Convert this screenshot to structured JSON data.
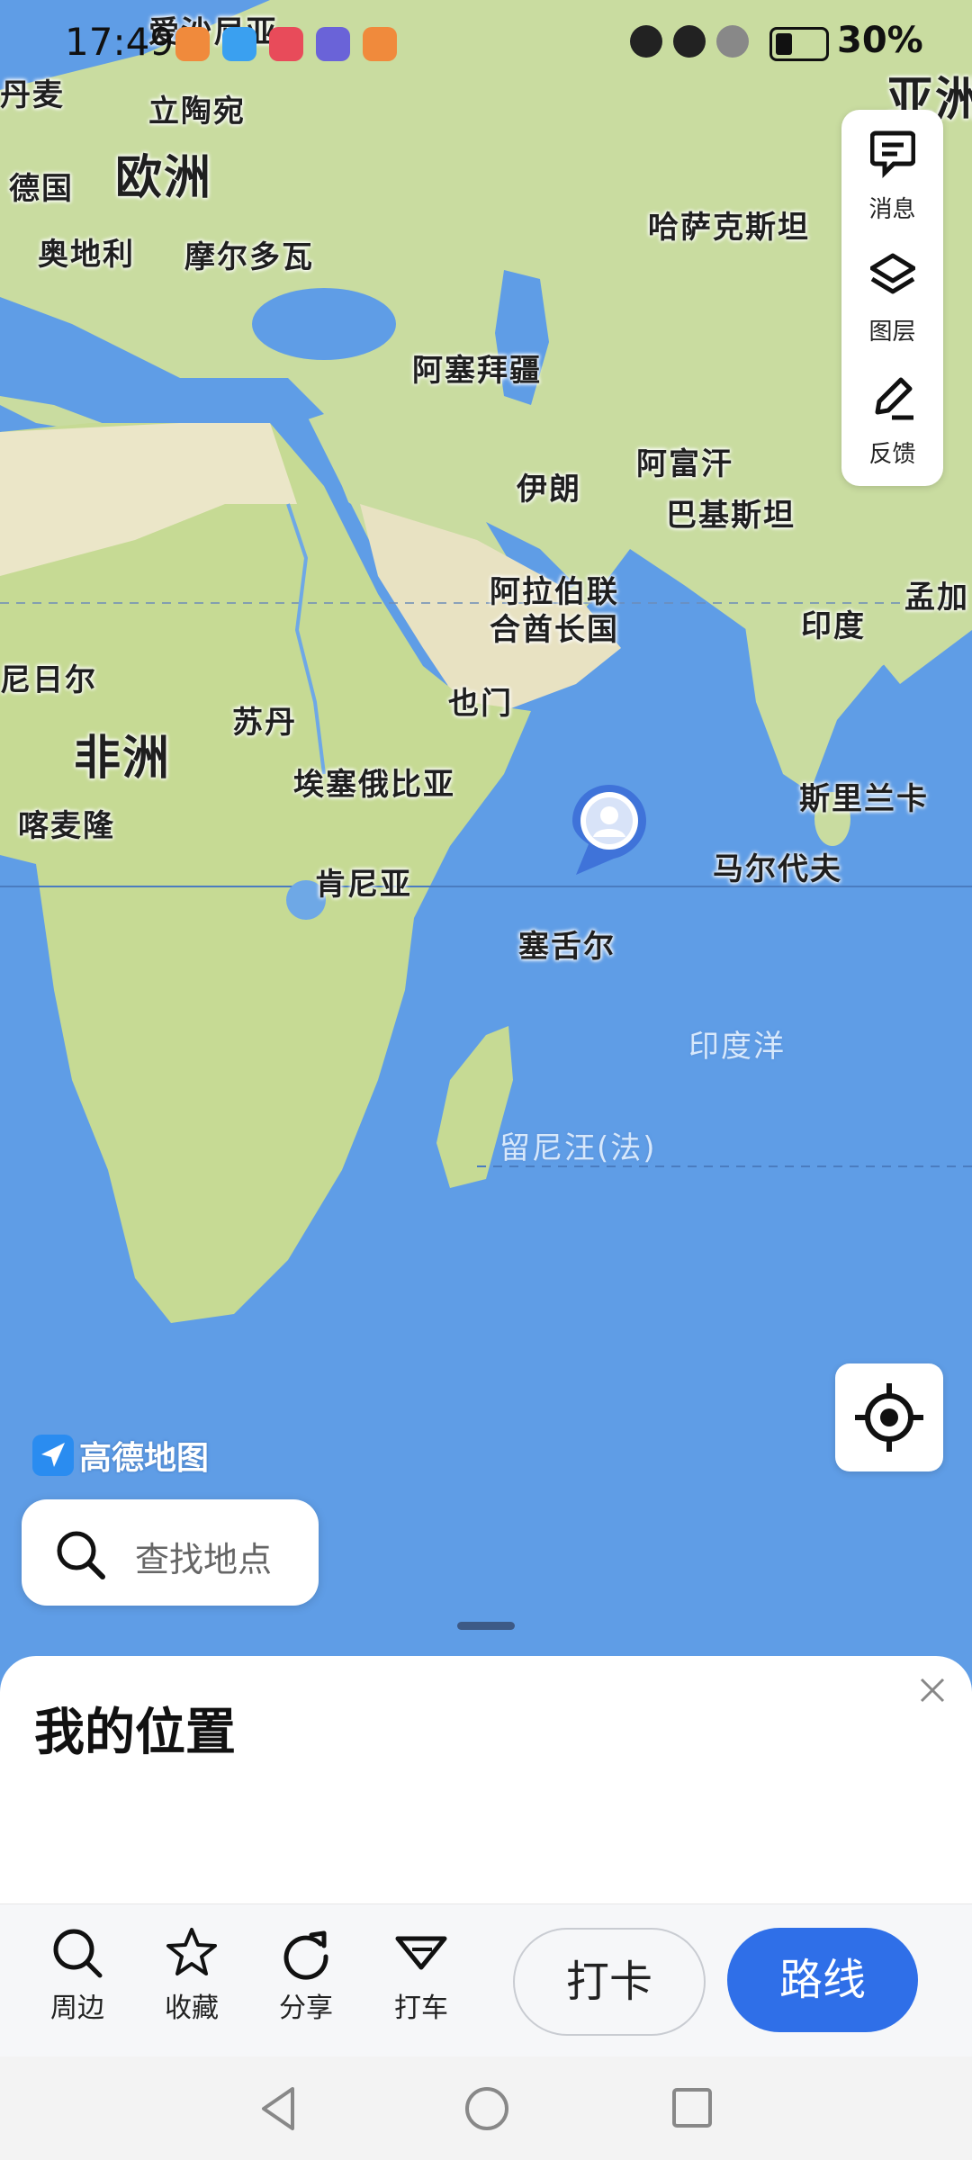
{
  "status_bar": {
    "time": "17:49",
    "battery": "30%"
  },
  "map": {
    "labels": {
      "estonia": "爱沙尼亚",
      "denmark": "丹麦",
      "lithuania": "立陶宛",
      "europe": "欧洲",
      "germany": "德国",
      "austria": "奥地利",
      "moldova": "摩尔多瓦",
      "asia": "亚洲",
      "kazakhstan": "哈萨克斯坦",
      "azerbaijan": "阿塞拜疆",
      "iran": "伊朗",
      "afghanistan": "阿富汗",
      "pakistan": "巴基斯坦",
      "uae_line1": "阿拉伯联",
      "uae_line2": "合酋长国",
      "india": "印度",
      "bangladesh": "孟加",
      "niger": "尼日尔",
      "africa": "非洲",
      "sudan": "苏丹",
      "yemen": "也门",
      "ethiopia": "埃塞俄比亚",
      "sri_lanka": "斯里兰卡",
      "cameroon": "喀麦隆",
      "kenya": "肯尼亚",
      "maldives": "马尔代夫",
      "seychelles": "塞舌尔",
      "indian_ocean": "印度洋",
      "reunion": "留尼汪(法)"
    },
    "brand": "高德地图"
  },
  "right_panel": {
    "messages": "消息",
    "layers": "图层",
    "feedback": "反馈"
  },
  "search": {
    "placeholder": "查找地点"
  },
  "sheet": {
    "title": "我的位置"
  },
  "actions": {
    "nearby": "周边",
    "favorite": "收藏",
    "share": "分享",
    "taxi": "打车",
    "checkin": "打卡",
    "route": "路线"
  }
}
